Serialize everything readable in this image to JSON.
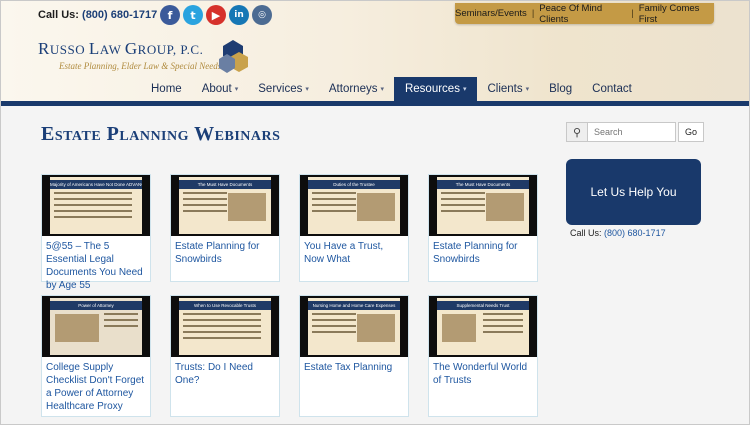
{
  "header": {
    "call_label": "Call Us:",
    "call_number": "(800) 680-1717",
    "social": [
      {
        "icon": "facebook-icon",
        "glyph": "f"
      },
      {
        "icon": "twitter-icon",
        "glyph": "t"
      },
      {
        "icon": "youtube-icon",
        "glyph": "▶"
      },
      {
        "icon": "linkedin-icon",
        "glyph": "in"
      },
      {
        "icon": "instagram-icon",
        "glyph": "◎"
      }
    ],
    "top_links": [
      "Seminars/Events",
      "Peace Of Mind Clients",
      "Family Comes First"
    ],
    "logo_name_first": "R",
    "logo_name_rest": "USSO ",
    "logo_name_2_first": "L",
    "logo_name_2_rest": "AW ",
    "logo_name_3_first": "G",
    "logo_name_3_rest": "ROUP, P.C.",
    "logo_tagline": "Estate Planning, Elder Law & Special Needs"
  },
  "nav": {
    "items": [
      {
        "label": "Home",
        "caret": ""
      },
      {
        "label": "About",
        "caret": "▾"
      },
      {
        "label": "Services",
        "caret": "▾"
      },
      {
        "label": "Attorneys",
        "caret": "▾"
      },
      {
        "label": "Resources",
        "caret": "▾",
        "active": true
      },
      {
        "label": "Clients",
        "caret": "▾"
      },
      {
        "label": "Blog",
        "caret": ""
      },
      {
        "label": "Contact",
        "caret": ""
      }
    ]
  },
  "main": {
    "title": "Estate Planning Webinars",
    "cards": [
      {
        "caption": "5@55 – The 5 Essential Legal Documents You Need by Age 55",
        "slide_title": "Majority of Americans Have Not Done ADVANCE PLANNING?"
      },
      {
        "caption": "Estate Planning for Snowbirds",
        "slide_title": "The Must Have Documents"
      },
      {
        "caption": "You Have a Trust, Now What",
        "slide_title": "Duties of the Trustee"
      },
      {
        "caption": "Estate Planning for Snowbirds",
        "slide_title": "The Must Have Documents"
      },
      {
        "caption": "College Supply Checklist Don't Forget a Power of Attorney Healthcare Proxy",
        "slide_title": "Power of Attorney"
      },
      {
        "caption": "Trusts: Do I Need One?",
        "slide_title": "When to Use Revocable Trusts"
      },
      {
        "caption": "Estate Tax Planning",
        "slide_title": "Nursing Home and Home Care Expenses"
      },
      {
        "caption": "The Wonderful World of Trusts",
        "slide_title": "Supplemental Needs Trust"
      }
    ]
  },
  "sidebar": {
    "search_placeholder": "Search",
    "go_label": "Go",
    "help_label": "Let Us Help You",
    "call_label": "Call Us:",
    "call_number": "(800) 680-1717"
  },
  "colors": {
    "brand_navy": "#19396b",
    "brand_gold": "#c49a45",
    "link_blue": "#1f57a0"
  }
}
